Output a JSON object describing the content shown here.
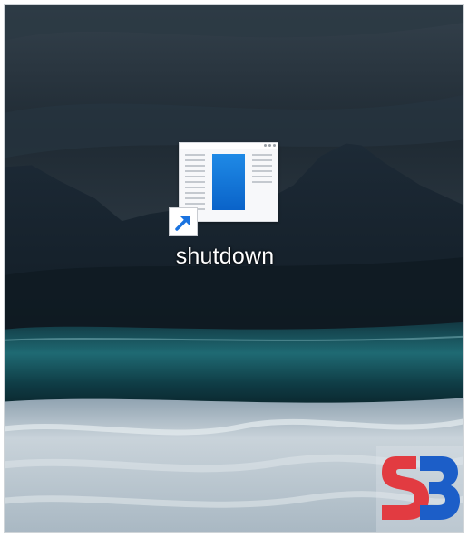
{
  "desktop": {
    "icons": [
      {
        "label": "shutdown",
        "icon": "app-window-shortcut-icon",
        "shortcut_overlay": "shortcut-arrow-icon",
        "accent_color": "#0f70d6"
      }
    ]
  },
  "watermark": {
    "logo": "sb-logo",
    "colors": [
      "#e23b41",
      "#1c5ec8"
    ]
  }
}
